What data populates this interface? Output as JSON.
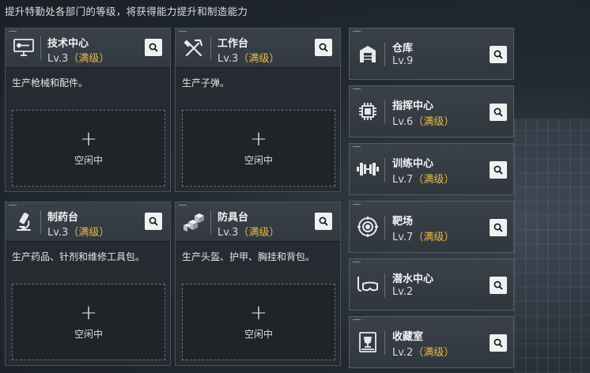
{
  "description": "提升特勤处各部门的等级，将获得能力提升和制造能力",
  "max_color": "#e8b84a",
  "slot": {
    "plus": "+",
    "idle_label": "空闲中"
  },
  "cards": [
    {
      "name": "技术中心",
      "level": "Lv.3",
      "max": "（满级）",
      "desc": "生产枪械和配件。",
      "icon": "computer-icon"
    },
    {
      "name": "工作台",
      "level": "Lv.3",
      "max": "（满级）",
      "desc": "生产子弹。",
      "icon": "tools-icon"
    },
    {
      "name": "制药台",
      "level": "Lv.3",
      "max": "（满级）",
      "desc": "生产药品、针剂和维修工具包。",
      "icon": "microscope-icon"
    },
    {
      "name": "防具台",
      "level": "Lv.3",
      "max": "（满级）",
      "desc": "生产头盔、护甲、胸挂和背包。",
      "icon": "armor-blocks-icon"
    }
  ],
  "side": [
    {
      "name": "仓库",
      "level": "Lv.9",
      "max": "",
      "icon": "warehouse-icon"
    },
    {
      "name": "指挥中心",
      "level": "Lv.6",
      "max": "（满级）",
      "icon": "chip-icon"
    },
    {
      "name": "训练中心",
      "level": "Lv.7",
      "max": "（满级）",
      "icon": "dumbbell-icon"
    },
    {
      "name": "靶场",
      "level": "Lv.7",
      "max": "（满级）",
      "icon": "target-icon"
    },
    {
      "name": "潜水中心",
      "level": "Lv.2",
      "max": "",
      "icon": "diving-mask-icon"
    },
    {
      "name": "收藏室",
      "level": "Lv.2",
      "max": "（满级）",
      "icon": "trophy-case-icon"
    }
  ]
}
